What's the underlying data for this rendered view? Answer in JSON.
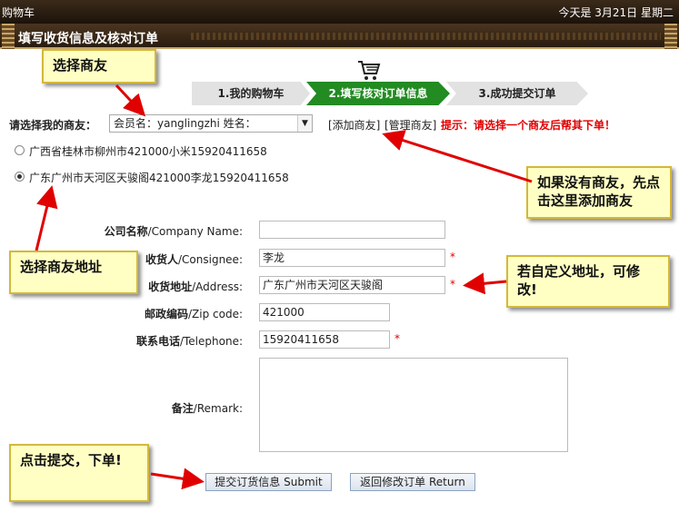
{
  "topbar": {
    "site": "购物车",
    "date": "今天是  3月21日 星期二"
  },
  "header": {
    "title": "填写收货信息及核对订单"
  },
  "steps": [
    "1.我的购物车",
    "2.填写核对订单信息",
    "3.成功提交订单"
  ],
  "friend": {
    "label": "请选择我的商友：",
    "selected": "会员名：yanglingzhi  姓名：",
    "add_link": "[添加商友]",
    "manage_link": "[管理商友]",
    "hint": "提示：请选择一个商友后帮其下单！"
  },
  "addresses": [
    {
      "text": "广西省桂林市柳州市421000小米15920411658",
      "selected": false
    },
    {
      "text": "广东广州市天河区天骏阁421000李龙15920411658",
      "selected": true
    }
  ],
  "form": {
    "company": {
      "label_cn": "公司名称",
      "label_en": "/Company Name:",
      "value": ""
    },
    "consignee": {
      "label_cn": "收货人",
      "label_en": "/Consignee:",
      "value": "李龙"
    },
    "address": {
      "label_cn": "收货地址",
      "label_en": "/Address:",
      "value": "广东广州市天河区天骏阁"
    },
    "zip": {
      "label_cn": "邮政编码",
      "label_en": "/Zip code:",
      "value": "421000"
    },
    "phone": {
      "label_cn": "联系电话",
      "label_en": "/Telephone:",
      "value": "15920411658"
    },
    "remark": {
      "label_cn": "备注",
      "label_en": "/Remark:",
      "value": ""
    },
    "required_mark": "*"
  },
  "buttons": {
    "submit": "提交订货信息 Submit",
    "return": "返回修改订单 Return"
  },
  "callouts": {
    "select_friend": "选择商友",
    "add_friend": "如果没有商友，先点击这里添加商友",
    "select_address": "选择商友地址",
    "custom_address": "若自定义地址，可修改!",
    "submit": "点击提交，下单!"
  },
  "colors": {
    "step_active": "#228b22",
    "hint": "#e00000",
    "callout_bg": "#ffffc4",
    "arrow": "#e00000"
  }
}
